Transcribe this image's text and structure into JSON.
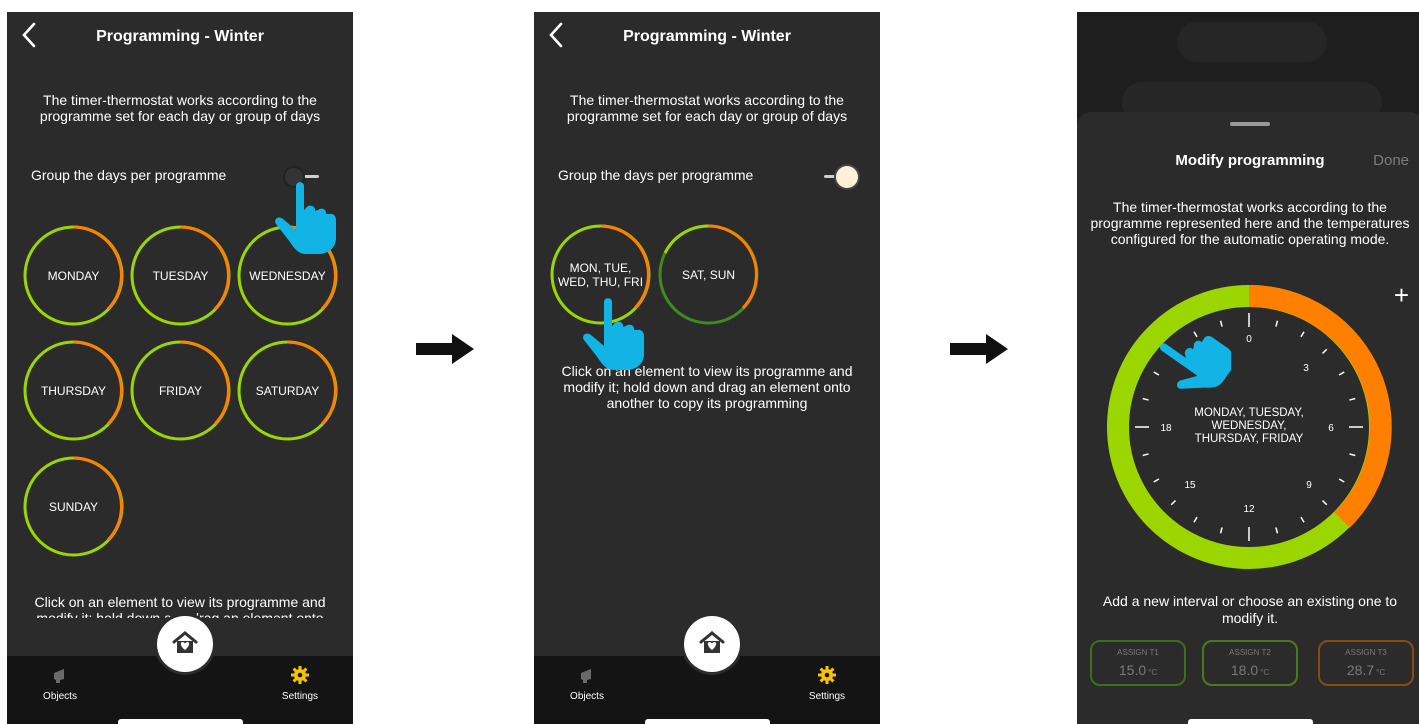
{
  "screen1": {
    "title": "Programming - Winter",
    "intro": "The timer-thermostat works according to the programme set for each day or group of days",
    "group_label": "Group the days per programme",
    "days": [
      "MONDAY",
      "TUESDAY",
      "WEDNESDAY",
      "THURSDAY",
      "FRIDAY",
      "SATURDAY",
      "SUNDAY"
    ],
    "hint": "Click on an element to view its programme and modify it; hold down and drag an element onto another to copy"
  },
  "screen2": {
    "title": "Programming - Winter",
    "intro": "The timer-thermostat works according to the programme set for each day or group of days",
    "group_label": "Group the days per programme",
    "groups": [
      {
        "label_line1": "MON, TUE,",
        "label_line2": "WED, THU, FRI"
      },
      {
        "label_line1": "SAT, SUN",
        "label_line2": ""
      }
    ],
    "hint": "Click on an element to view its programme and modify it; hold down and drag an element onto another to copy its programming"
  },
  "screen3": {
    "title": "Modify programming",
    "done": "Done",
    "description": "The timer-thermostat works according to the programme represented here and the temperatures configured for the automatic operating mode.",
    "plus": "+",
    "clock_center": [
      "MONDAY, TUESDAY,",
      "WEDNESDAY,",
      "THURSDAY, FRIDAY"
    ],
    "hour_labels": [
      "0",
      "3",
      "6",
      "9",
      "12",
      "15",
      "18"
    ],
    "add_hint": "Add a new interval or choose an existing one to modify it.",
    "assign": [
      {
        "label": "ASSIGN T1",
        "value": "15.0",
        "unit": "°C",
        "color": "#3f6e1a"
      },
      {
        "label": "ASSIGN T2",
        "value": "18.0",
        "unit": "°C",
        "color": "#4b7a1e"
      },
      {
        "label": "ASSIGN T3",
        "value": "28.7",
        "unit": "°C",
        "color": "#8a4a10"
      }
    ]
  },
  "nav": {
    "objects": "Objects",
    "settings": "Settings"
  },
  "colors": {
    "green": "#9bd600",
    "orange": "#ff8000",
    "dark_green": "#3e8a1e",
    "pointer": "#11b4e4"
  }
}
